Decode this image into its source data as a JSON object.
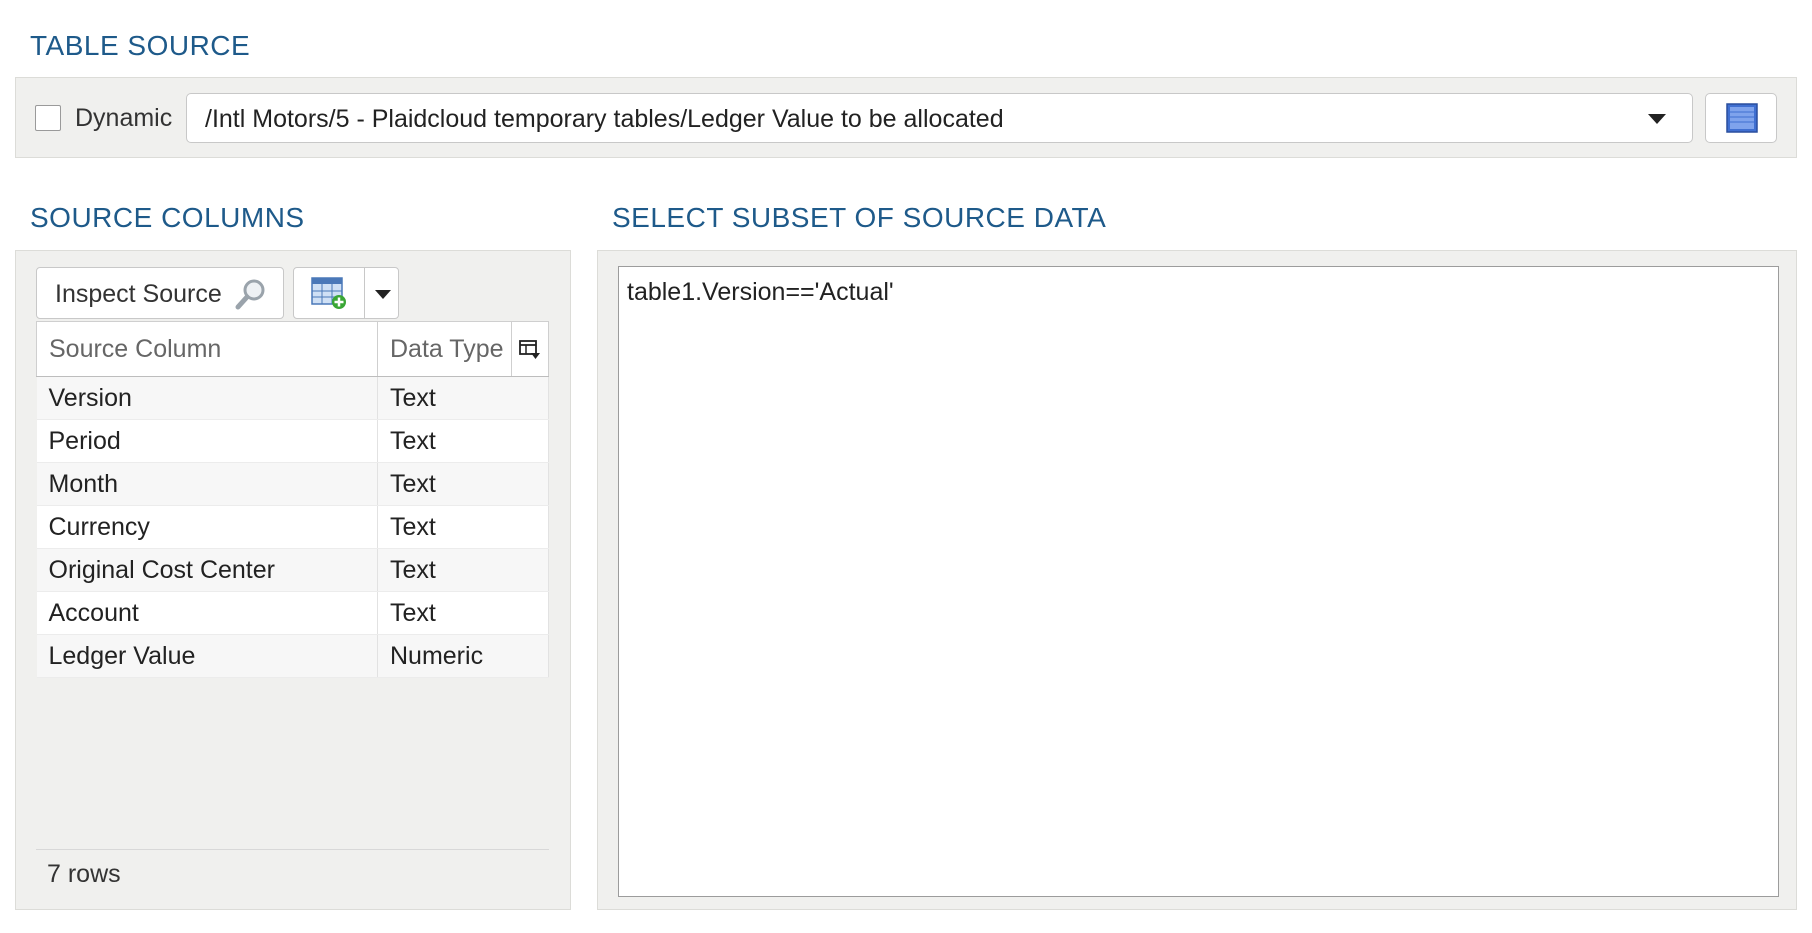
{
  "table_source": {
    "title": "TABLE SOURCE",
    "dynamic_label": "Dynamic",
    "dynamic_checked": false,
    "selected_table": "/Intl Motors/5 - Plaidcloud temporary tables/Ledger Value to be allocated",
    "picker_icon": "table-grid-icon"
  },
  "source_columns": {
    "title": "SOURCE COLUMNS",
    "inspect_label": "Inspect Source",
    "inspect_icon": "magnifier-icon",
    "add_icon": "add-table-icon",
    "headers": {
      "column": "Source Column",
      "type": "Data Type"
    },
    "rows": [
      {
        "column": "Version",
        "type": "Text"
      },
      {
        "column": "Period",
        "type": "Text"
      },
      {
        "column": "Month",
        "type": "Text"
      },
      {
        "column": "Currency",
        "type": "Text"
      },
      {
        "column": "Original Cost Center",
        "type": "Text"
      },
      {
        "column": "Account",
        "type": "Text"
      },
      {
        "column": "Ledger Value",
        "type": "Numeric"
      }
    ],
    "row_count": "7 rows"
  },
  "subset": {
    "title": "SELECT SUBSET OF SOURCE DATA",
    "expression": "table1.Version=='Actual'"
  },
  "colors": {
    "section_title": "#1e5a8a",
    "panel_bg": "#f0f0ee"
  }
}
